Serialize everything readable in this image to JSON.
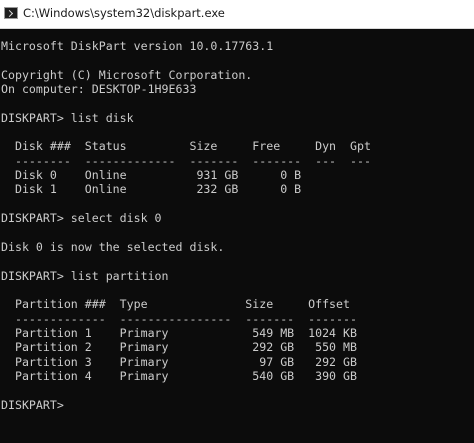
{
  "window": {
    "title": "C:\\Windows\\system32\\diskpart.exe",
    "icon": "console-icon"
  },
  "console": {
    "lines": [
      "Microsoft DiskPart version 10.0.17763.1",
      "",
      "Copyright (C) Microsoft Corporation.",
      "On computer: DESKTOP-1H9E633",
      "",
      "DISKPART> list disk",
      "",
      "  Disk ###  Status         Size     Free     Dyn  Gpt",
      "  --------  -------------  -------  -------  ---  ---",
      "  Disk 0    Online          931 GB      0 B",
      "  Disk 1    Online          232 GB      0 B",
      "",
      "DISKPART> select disk 0",
      "",
      "Disk 0 is now the selected disk.",
      "",
      "DISKPART> list partition",
      "",
      "  Partition ###  Type              Size     Offset",
      "  -------------  ----------------  -------  -------",
      "  Partition 1    Primary            549 MB  1024 KB",
      "  Partition 2    Primary            292 GB   550 MB",
      "  Partition 3    Primary             97 GB   292 GB",
      "  Partition 4    Primary            540 GB   390 GB",
      "",
      "DISKPART> "
    ]
  },
  "colors": {
    "background": "#0c0c0c",
    "foreground": "#cccccc",
    "titlebar": "#ffffff"
  }
}
